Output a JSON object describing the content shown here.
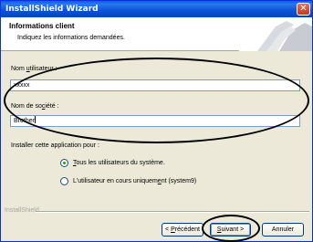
{
  "window": {
    "title": "InstallShield Wizard",
    "close_glyph": "✕"
  },
  "header": {
    "title": "Informations client",
    "subtitle": "Indiquez les informations demandées."
  },
  "user_name": {
    "label_pre": "Nom ",
    "label_u": "u",
    "label_post": "tilisateur :",
    "value": "xxxxx"
  },
  "company": {
    "label_pre": "Nom de so",
    "label_u": "c",
    "label_post": "iété :",
    "value": "Brother"
  },
  "install_for": {
    "label": "Installer cette application pour :",
    "options": [
      {
        "pre": "",
        "u": "T",
        "post": "ous les utilisateurs du système.",
        "checked": true
      },
      {
        "pre": "L'utilisateur en cours uniquem",
        "u": "e",
        "post": "nt (system9)",
        "checked": false
      }
    ]
  },
  "footer": {
    "brand": "InstallShield"
  },
  "buttons": {
    "back": {
      "pre": "< ",
      "u": "P",
      "post": "récédent"
    },
    "next": {
      "pre": "",
      "u": "S",
      "post": "uivant >"
    },
    "cancel": "Annuler"
  }
}
